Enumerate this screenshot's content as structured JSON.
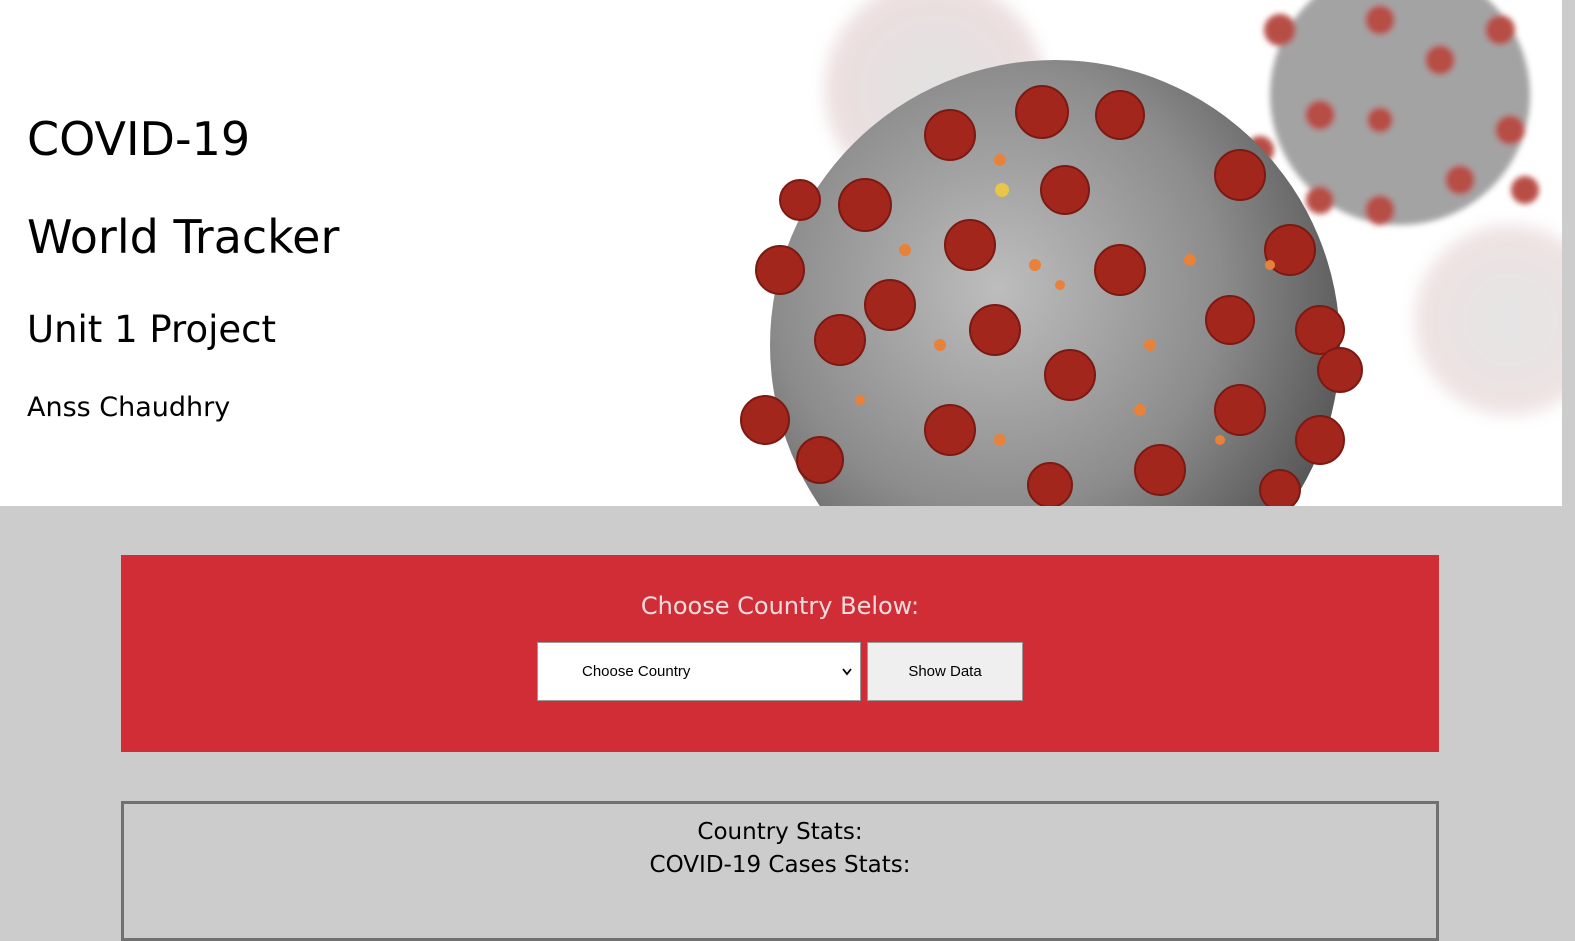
{
  "header": {
    "title_line1": "COVID-19",
    "title_line2": "World Tracker",
    "subtitle": "Unit 1 Project",
    "author": "Anss Chaudhry",
    "image_icon": "coronavirus-illustration"
  },
  "picker": {
    "prompt": "Choose Country Below:",
    "select_value": "Choose Country",
    "button_label": "Show Data"
  },
  "stats": {
    "country_label": "Country Stats:",
    "cases_label": "COVID-19 Cases Stats:"
  },
  "colors": {
    "page_background": "#cccccc",
    "panel_red": "#d02d37",
    "virus_red": "#a8281f",
    "virus_gray": "#8a8a8a"
  }
}
